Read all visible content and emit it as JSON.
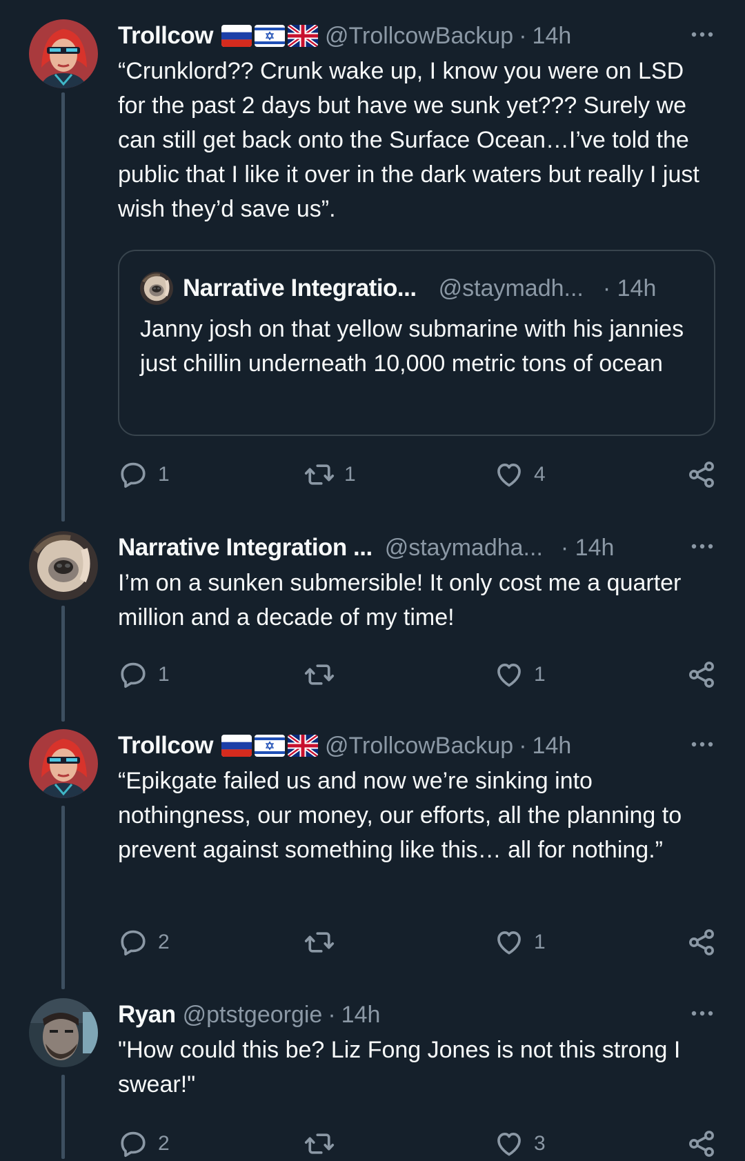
{
  "colors": {
    "background": "#15202b",
    "text": "#f7f9f9",
    "muted": "#8b98a5",
    "border": "#38444d",
    "thread_line": "#3d4f60"
  },
  "tweets": [
    {
      "name": "Trollcow",
      "flags": [
        "flag-russia-icon",
        "flag-israel-icon",
        "flag-uk-icon"
      ],
      "handle": "@TrollcowBackup",
      "time": "14h",
      "text": "“Crunklord?? Crunk wake up, I know you were on LSD for the past 2 days but have we sunk yet??? Surely we can still get back onto the Surface Ocean…I’ve told the public that I like it over in the dark waters but really I just wish they’d save us”.",
      "quote": {
        "name": "Narrative Integratio...",
        "handle": "@staymadh...",
        "time": "· 14h",
        "text": "Janny josh on that yellow submarine with his jannies just chillin underneath 10,000 metric tons of ocean"
      },
      "replies": "1",
      "retweets": "1",
      "likes": "4"
    },
    {
      "name": "Narrative Integration ...",
      "handle": "@staymadha...",
      "time": "· 14h",
      "text": "I’m on a sunken submersible! It only cost me a quarter million and a decade of my time!",
      "replies": "1",
      "retweets": "",
      "likes": "1"
    },
    {
      "name": "Trollcow",
      "flags": [
        "flag-russia-icon",
        "flag-israel-icon",
        "flag-uk-icon"
      ],
      "handle": "@TrollcowBackup",
      "time": "14h",
      "text": "“Epikgate failed us and now we’re sinking into nothingness, our money, our efforts, all the planning to prevent against something like this… all for nothing.”",
      "replies": "2",
      "retweets": "",
      "likes": "1"
    },
    {
      "name": "Ryan",
      "handle": "@ptstgeorgie",
      "time": "14h",
      "text": "\"How could this be? Liz Fong Jones is not this strong I swear!\"",
      "replies": "2",
      "retweets": "",
      "likes": "3"
    }
  ]
}
